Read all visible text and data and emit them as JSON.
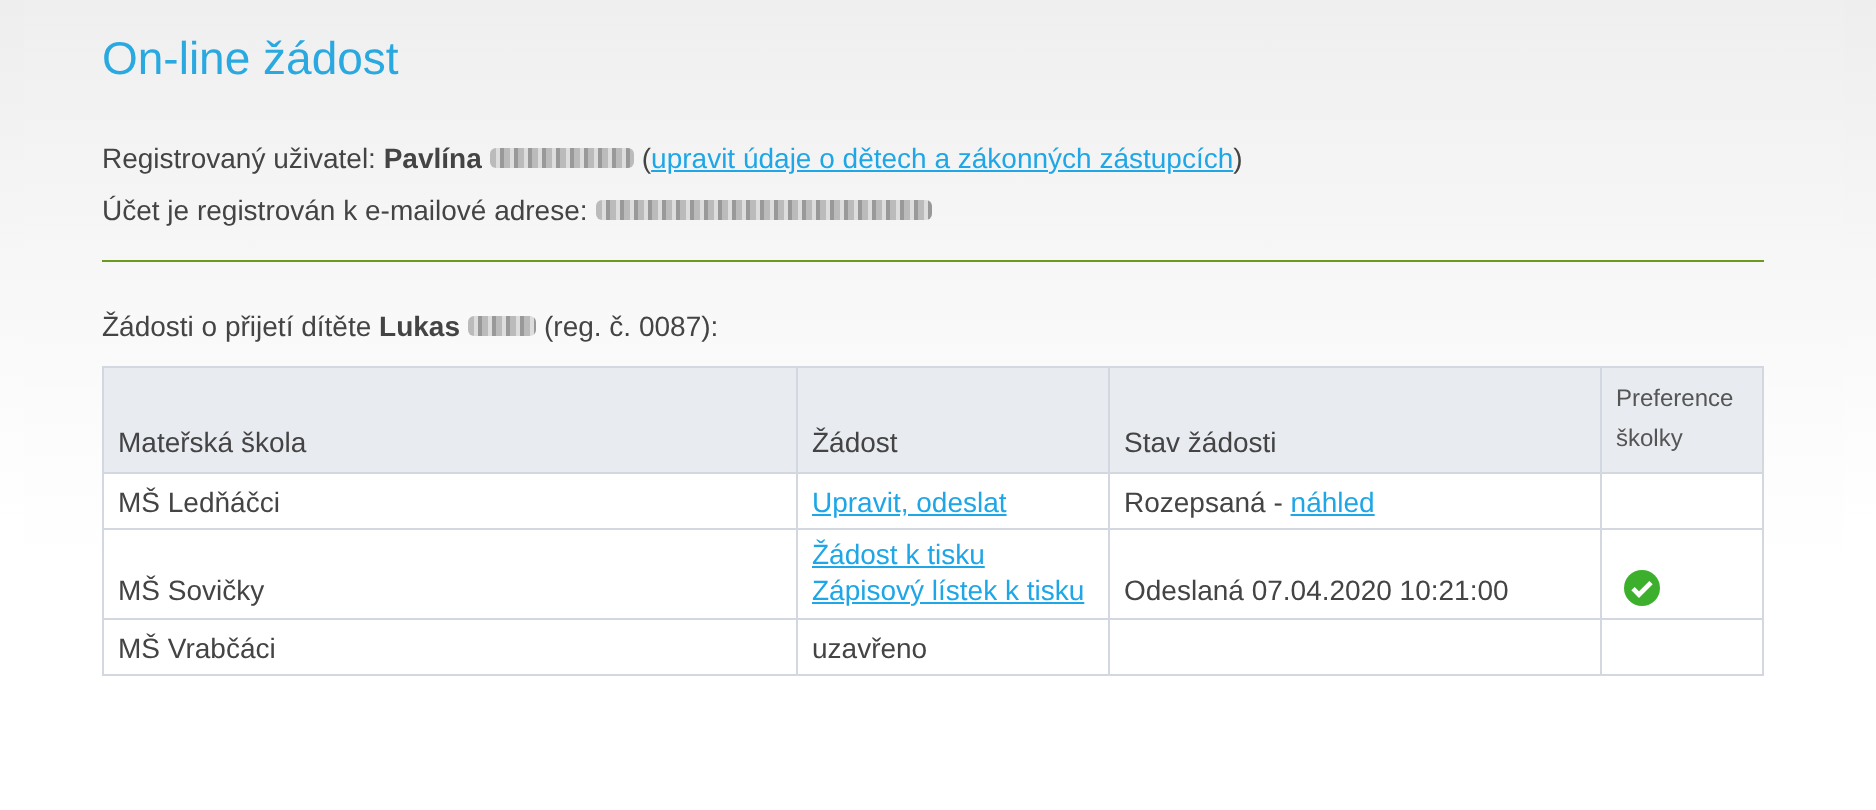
{
  "title": "On-line žádost",
  "user": {
    "label": "Registrovaný uživatel:",
    "name": "Pavlína",
    "link_open": "(",
    "link": "upravit údaje o dětech a zákonných zástupcích",
    "link_close": ")"
  },
  "account": {
    "label": "Účet je registrován k e-mailové adrese:"
  },
  "requests_heading": {
    "before": "Žádosti o přijetí dítěte",
    "child": "Lukas",
    "after": "(reg. č. 0087):"
  },
  "table": {
    "columns": [
      "Mateřská škola",
      "Žádost",
      "Stav žádosti",
      "Preference školky"
    ],
    "rows": [
      {
        "school": "MŠ Ledňáčci",
        "actions": [
          {
            "kind": "link",
            "text": "Upravit, odeslat"
          }
        ],
        "status": "Rozepsaná -",
        "status_link": "náhled",
        "preferred": false
      },
      {
        "school": "MŠ Sovičky",
        "actions": [
          {
            "kind": "link",
            "text": "Žádost k tisku"
          },
          {
            "kind": "link",
            "text": "Zápisový lístek k tisku"
          }
        ],
        "status": "Odeslaná 07.04.2020 10:21:00",
        "preferred": true
      },
      {
        "school": "MŠ Vrabčáci",
        "actions": [
          {
            "kind": "text",
            "text": "uzavřeno"
          }
        ],
        "preferred": false
      }
    ]
  }
}
